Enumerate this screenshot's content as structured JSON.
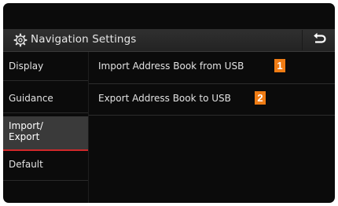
{
  "header": {
    "title": "Navigation Settings",
    "settings_icon": "gear-icon",
    "back_icon": "back-arrow-icon"
  },
  "sidebar": {
    "items": [
      {
        "label": "Display",
        "active": false
      },
      {
        "label": "Guidance",
        "active": false
      },
      {
        "label": "Import/\nExport",
        "active": true
      },
      {
        "label": "Default",
        "active": false
      }
    ]
  },
  "main": {
    "options": [
      {
        "label": "Import Address Book from USB",
        "callout": "1"
      },
      {
        "label": "Export Address Book to USB",
        "callout": "2"
      }
    ]
  },
  "colors": {
    "accent": "#d0282a",
    "callout": "#f07c14"
  }
}
